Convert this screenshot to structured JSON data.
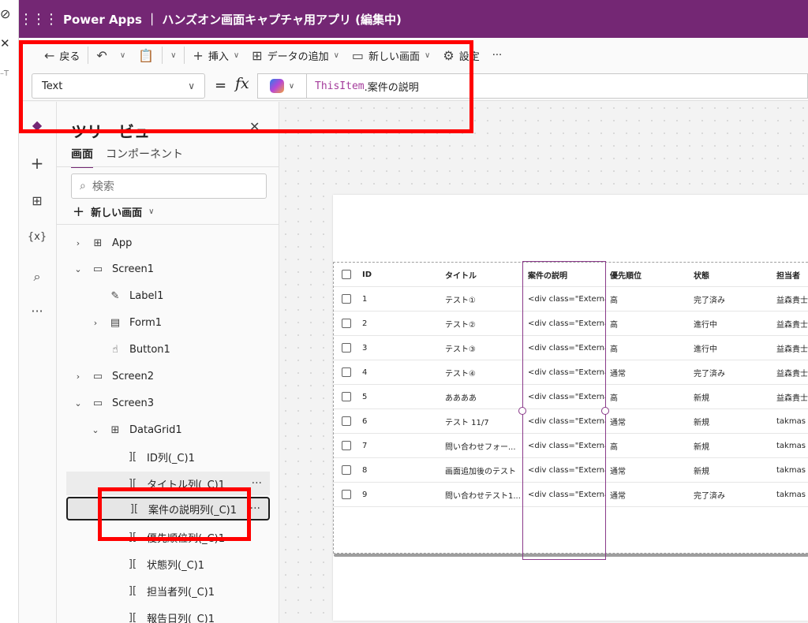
{
  "browser": {
    "glyph_top": "⊘",
    "glyph_close": "✕",
    "glyph_text": "–T"
  },
  "app": {
    "waffle": "⋮⋮⋮",
    "title": "Power Apps ｜ ハンズオン画面キャプチャ用アプリ (編集中)"
  },
  "toolbar": {
    "back": {
      "icon": "arrow-left-icon",
      "glyph": "←",
      "label": "戻る"
    },
    "undo": {
      "icon": "undo-icon",
      "glyph": "↶"
    },
    "paste": {
      "icon": "clipboard-icon",
      "glyph": "📋"
    },
    "insert": {
      "icon": "plus-icon",
      "glyph": "+",
      "label": "挿入"
    },
    "add_data": {
      "icon": "table-add-icon",
      "glyph": "⊞",
      "label": "データの追加"
    },
    "new_screen": {
      "icon": "screen-add-icon",
      "glyph": "▭",
      "label": "新しい画面"
    },
    "settings": {
      "icon": "gear-icon",
      "glyph": "⚙",
      "label": "設定"
    },
    "more": "···"
  },
  "formula": {
    "property": "Text",
    "equals": "=",
    "fx": "fx",
    "keyword": "ThisItem",
    "rest": ".案件の説明"
  },
  "rail": [
    {
      "name": "layers-icon",
      "glyph": "◆"
    },
    {
      "name": "plus-icon",
      "glyph": "+"
    },
    {
      "name": "data-icon",
      "glyph": "⊞"
    },
    {
      "name": "variables-icon",
      "glyph": "{x}"
    },
    {
      "name": "search-icon",
      "glyph": "⌕"
    },
    {
      "name": "more-icon",
      "glyph": "···"
    }
  ],
  "tree": {
    "title": "ツリービュー",
    "close": "✕",
    "tabs": [
      "画面",
      "コンポーネント"
    ],
    "search_placeholder": "検索",
    "new_screen": "新しい画面",
    "nodes": [
      {
        "label": "App",
        "exp": "›",
        "icon": "⊞"
      },
      {
        "label": "Screen1",
        "exp": "⌄",
        "icon": "▭"
      },
      {
        "label": "Label1",
        "exp": "",
        "icon": "✎"
      },
      {
        "label": "Form1",
        "exp": "›",
        "icon": "▤"
      },
      {
        "label": "Button1",
        "exp": "",
        "icon": "☝"
      },
      {
        "label": "Screen2",
        "exp": "›",
        "icon": "▭"
      },
      {
        "label": "Screen3",
        "exp": "⌄",
        "icon": "▭"
      },
      {
        "label": "DataGrid1",
        "exp": "⌄",
        "icon": "⊞"
      },
      {
        "label": "ID列(_C)1",
        "exp": "",
        "icon": "]["
      },
      {
        "label": "タイトル列(_C)1",
        "exp": "",
        "icon": "][",
        "more": "···"
      },
      {
        "label": "案件の説明列(_C)1",
        "exp": "",
        "icon": "][",
        "more": "···"
      },
      {
        "label": "優先順位列(_C)1",
        "exp": "",
        "icon": "]["
      },
      {
        "label": "状態列(_C)1",
        "exp": "",
        "icon": "]["
      },
      {
        "label": "担当者列(_C)1",
        "exp": "",
        "icon": "]["
      },
      {
        "label": "報告日列(_C)1",
        "exp": "",
        "icon": "]["
      }
    ]
  },
  "grid": {
    "headers": [
      "ID",
      "タイトル",
      "案件の説明",
      "優先順位",
      "状態",
      "担当者"
    ],
    "rows": [
      [
        "1",
        "テスト①",
        "<div class=\"Externa...",
        "高",
        "完了済み",
        "益森貴士"
      ],
      [
        "2",
        "テスト②",
        "<div class=\"Externa...",
        "高",
        "進行中",
        "益森貴士"
      ],
      [
        "3",
        "テスト③",
        "<div class=\"Externa...",
        "高",
        "進行中",
        "益森貴士"
      ],
      [
        "4",
        "テスト④",
        "<div class=\"Externa...",
        "通常",
        "完了済み",
        "益森貴士"
      ],
      [
        "5",
        "ああああ",
        "<div class=\"Externa...",
        "高",
        "新規",
        "益森貴士"
      ],
      [
        "6",
        "テスト 11/7",
        "<div class=\"Externa...",
        "通常",
        "新規",
        "takmas ta"
      ],
      [
        "7",
        "問い合わせフォー...",
        "<div class=\"Externa...",
        "高",
        "新規",
        "takmas ta"
      ],
      [
        "8",
        "画面追加後のテスト",
        "<div class=\"Externa...",
        "通常",
        "新規",
        "takmas ta"
      ],
      [
        "9",
        "問い合わせテスト1...",
        "<div class=\"Externa...",
        "通常",
        "完了済み",
        "takmas ta"
      ]
    ]
  },
  "colors": {
    "brand": "#742774",
    "highlight": "#ff0000",
    "selection": "#8a3a8a"
  }
}
